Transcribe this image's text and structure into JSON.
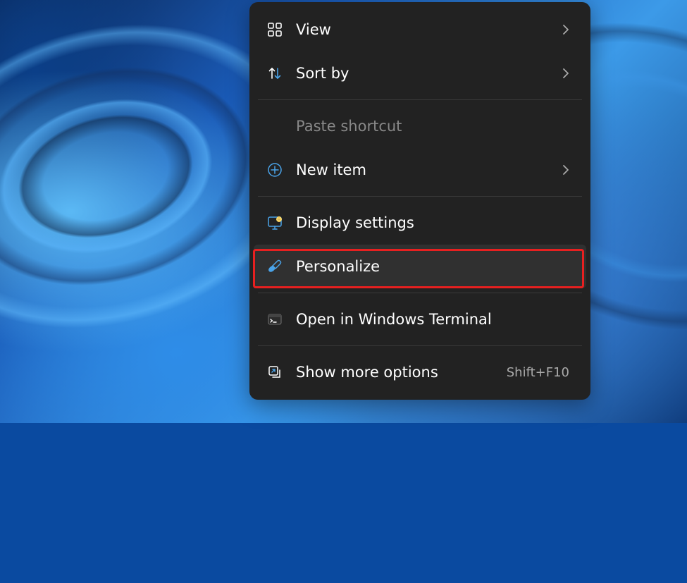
{
  "menu": {
    "items": [
      {
        "id": "view",
        "label": "View",
        "icon": "grid-icon",
        "submenu": true
      },
      {
        "id": "sort",
        "label": "Sort by",
        "icon": "sort-icon",
        "submenu": true
      },
      {
        "separator": true
      },
      {
        "id": "paste-shortcut",
        "label": "Paste shortcut",
        "disabled": true,
        "noIcon": true
      },
      {
        "id": "new-item",
        "label": "New item",
        "icon": "plus-circle-icon",
        "submenu": true
      },
      {
        "separator": true
      },
      {
        "id": "display-settings",
        "label": "Display settings",
        "icon": "display-gear-icon"
      },
      {
        "id": "personalize",
        "label": "Personalize",
        "icon": "brush-icon",
        "highlighted": true,
        "hover": true
      },
      {
        "separator": true
      },
      {
        "id": "open-terminal",
        "label": "Open in Windows Terminal",
        "icon": "terminal-icon"
      },
      {
        "separator": true
      },
      {
        "id": "more-options",
        "label": "Show more options",
        "icon": "more-options-icon",
        "shortcut": "Shift+F10"
      }
    ]
  },
  "colors": {
    "highlight_border": "#e72020",
    "accent": "#4aa3e8"
  }
}
